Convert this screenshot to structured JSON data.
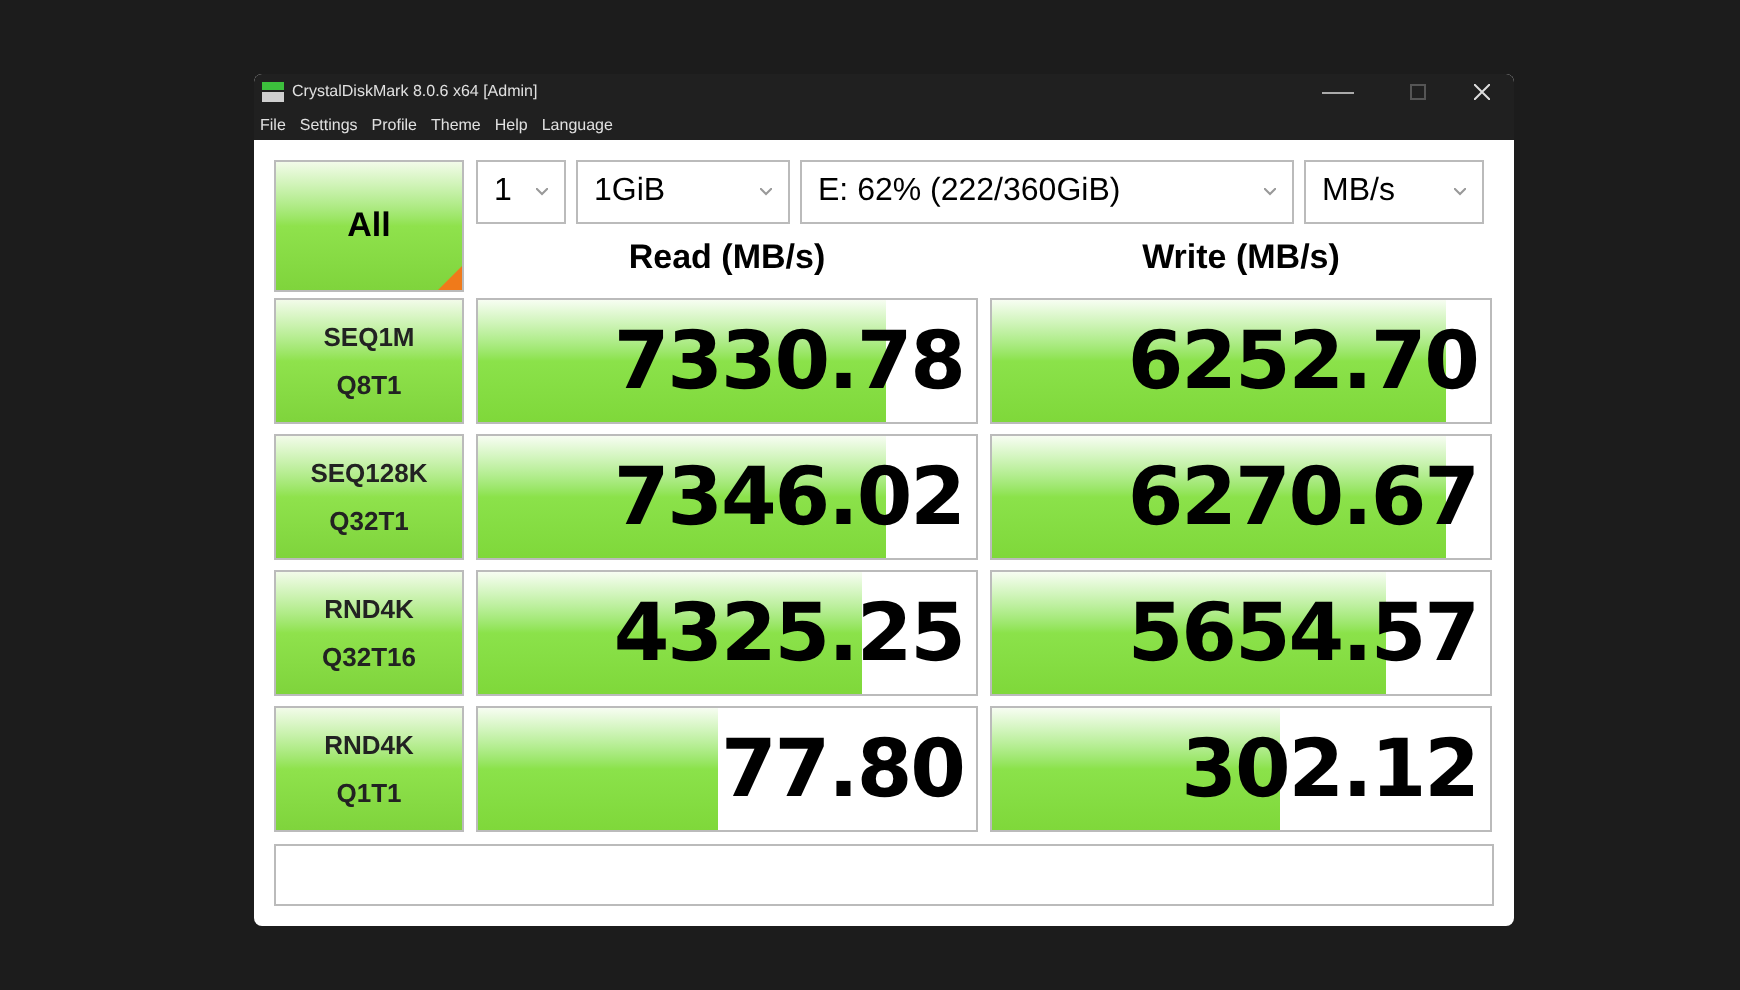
{
  "window": {
    "title": "CrystalDiskMark 8.0.6 x64 [Admin]"
  },
  "menu": [
    "File",
    "Settings",
    "Profile",
    "Theme",
    "Help",
    "Language"
  ],
  "all_button": {
    "label": "All"
  },
  "selectors": [
    {
      "value": "1"
    },
    {
      "value": "1GiB"
    },
    {
      "value": "E: 62% (222/360GiB)"
    },
    {
      "value": "MB/s"
    }
  ],
  "headers": [
    "Read (MB/s)",
    "Write (MB/s)"
  ],
  "tests": [
    {
      "line1": "SEQ1M",
      "line2": "Q8T1",
      "read": {
        "value": "7330.78",
        "level": 0.82
      },
      "write": {
        "value": "6252.70",
        "level": 0.91
      }
    },
    {
      "line1": "SEQ128K",
      "line2": "Q32T1",
      "read": {
        "value": "7346.02",
        "level": 0.82
      },
      "write": {
        "value": "6270.67",
        "level": 0.91
      }
    },
    {
      "line1": "RND4K",
      "line2": "Q32T16",
      "read": {
        "value": "4325.25",
        "level": 0.77
      },
      "write": {
        "value": "5654.57",
        "level": 0.79
      }
    },
    {
      "line1": "RND4K",
      "line2": "Q1T1",
      "read": {
        "value": "77.80",
        "level": 0.48
      },
      "write": {
        "value": "302.12",
        "level": 0.58
      }
    }
  ]
}
